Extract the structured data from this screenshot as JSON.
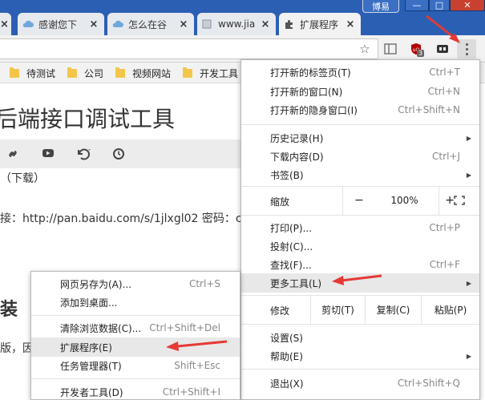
{
  "window": {
    "user_button": "博易",
    "minimize": "—",
    "maximize": "□",
    "close": "✕"
  },
  "tabs": [
    {
      "title": "感谢您下",
      "icon": "cloud-icon",
      "close": "×"
    },
    {
      "title": "怎么在谷",
      "icon": "cloud-icon",
      "close": "×"
    },
    {
      "title": "www.jia",
      "icon": "page-icon",
      "close": "×"
    },
    {
      "title": "扩展程序",
      "icon": "puzzle-icon",
      "close": "×",
      "active": true
    }
  ],
  "toolbar": {
    "star": "☆",
    "extension_badge": "3"
  },
  "bookmarks": [
    "待测试",
    "公司",
    "视频网站",
    "开发工具"
  ],
  "page": {
    "title": "后端接口调试工具",
    "line1": "（下载）",
    "line2": "接：http://pan.baidu.com/s/1jlxgl02 密码：c",
    "heading2": "装",
    "line3": "版，因"
  },
  "main_menu": {
    "items_top": [
      {
        "label": "打开新的标签页(T)",
        "shortcut": "Ctrl+T"
      },
      {
        "label": "打开新的窗口(N)",
        "shortcut": "Ctrl+N"
      },
      {
        "label": "打开新的隐身窗口(I)",
        "shortcut": "Ctrl+Shift+N"
      }
    ],
    "items_history": [
      {
        "label": "历史记录(H)",
        "shortcut": "",
        "arrow": "▶"
      },
      {
        "label": "下载内容(D)",
        "shortcut": "Ctrl+J",
        "arrow": ""
      },
      {
        "label": "书签(B)",
        "shortcut": "",
        "arrow": "▶"
      }
    ],
    "zoom": {
      "label": "缩放",
      "minus": "−",
      "value": "100%",
      "plus": "+",
      "fullscreen": "⛶"
    },
    "items_tools": [
      {
        "label": "打印(P)...",
        "shortcut": "Ctrl+P",
        "arrow": ""
      },
      {
        "label": "投射(C)...",
        "shortcut": "",
        "arrow": ""
      },
      {
        "label": "查找(F)...",
        "shortcut": "Ctrl+F",
        "arrow": ""
      },
      {
        "label": "更多工具(L)",
        "shortcut": "",
        "arrow": "▶"
      }
    ],
    "edit": {
      "label": "修改",
      "cut": "剪切(T)",
      "copy": "复制(C)",
      "paste": "粘贴(P)"
    },
    "items_settings": [
      {
        "label": "设置(S)",
        "shortcut": "",
        "arrow": ""
      },
      {
        "label": "帮助(E)",
        "shortcut": "",
        "arrow": "▶"
      }
    ],
    "exit": {
      "label": "退出(X)",
      "shortcut": "Ctrl+Shift+Q"
    }
  },
  "sub_menu": {
    "group1": [
      {
        "label": "网页另存为(A)...",
        "shortcut": "Ctrl+S"
      },
      {
        "label": "添加到桌面...",
        "shortcut": ""
      }
    ],
    "group2": [
      {
        "label": "清除浏览数据(C)...",
        "shortcut": "Ctrl+Shift+Del"
      },
      {
        "label": "扩展程序(E)",
        "shortcut": ""
      },
      {
        "label": "任务管理器(T)",
        "shortcut": "Shift+Esc"
      }
    ],
    "group3": [
      {
        "label": "开发者工具(D)",
        "shortcut": "Ctrl+Shift+I"
      }
    ]
  },
  "colors": {
    "titlebar": "#2b5fb3",
    "annotation_arrow": "#e53935",
    "folder": "#f3c64a",
    "close_button": "#c8402f"
  }
}
